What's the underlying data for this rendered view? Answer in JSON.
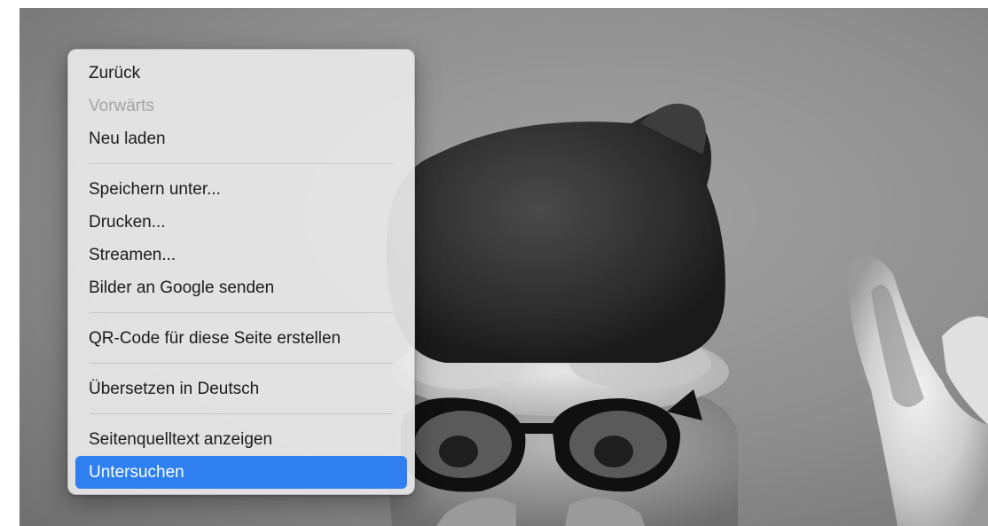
{
  "context_menu": {
    "items": [
      {
        "label": "Zurück",
        "enabled": true
      },
      {
        "label": "Vorwärts",
        "enabled": false
      },
      {
        "label": "Neu laden",
        "enabled": true
      },
      {
        "label": "Speichern unter...",
        "enabled": true
      },
      {
        "label": "Drucken...",
        "enabled": true
      },
      {
        "label": "Streamen...",
        "enabled": true
      },
      {
        "label": "Bilder an Google senden",
        "enabled": true
      },
      {
        "label": "QR-Code für diese Seite erstellen",
        "enabled": true
      },
      {
        "label": "Übersetzen in Deutsch",
        "enabled": true
      },
      {
        "label": "Seitenquelltext anzeigen",
        "enabled": true
      },
      {
        "label": "Untersuchen",
        "enabled": true,
        "highlighted": true
      }
    ],
    "highlight_color": "#2f7ff0"
  },
  "background": {
    "type": "grayscale photo: furry creature with black fur hat and black sunglasses, white llama ear at right"
  }
}
